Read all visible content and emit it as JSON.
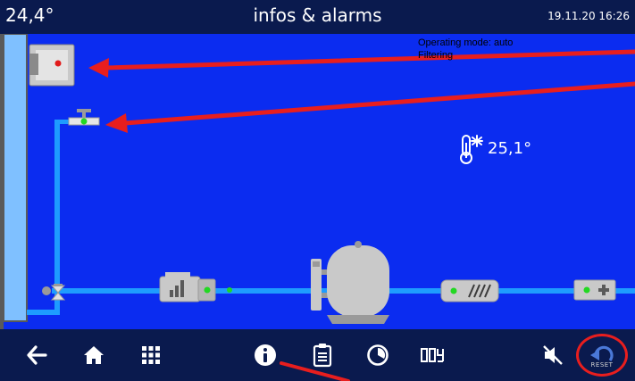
{
  "header": {
    "pool_temperature": "24,4°",
    "title": "infos & alarms",
    "datetime": "19.11.20 16:26"
  },
  "status": {
    "operating_mode": "Operating mode: auto",
    "state": "Filtering"
  },
  "setpoint": {
    "temperature": "25,1°",
    "icon": "thermometer-snowflake-icon"
  },
  "components": {
    "cover_unit": {
      "icon": "control-box-icon",
      "indicator_color": "#e11b1b"
    },
    "valve": {
      "icon": "valve-icon",
      "state": "open",
      "indicator_color": "#22d822"
    },
    "three_way_valve": {
      "icon": "three-way-valve-icon"
    },
    "pump": {
      "icon": "pump-icon",
      "status": "running",
      "indicator_color": "#22d822"
    },
    "filter": {
      "icon": "sand-filter-icon"
    },
    "heater": {
      "icon": "heater-icon",
      "status": "on",
      "indicator_color": "#22d822"
    },
    "dosing": {
      "icon": "chlorine-dosing-icon",
      "indicator_color": "#22d822"
    }
  },
  "bottom_nav": [
    {
      "name": "back-arrow-icon",
      "label": "back"
    },
    {
      "name": "home-icon",
      "label": "home"
    },
    {
      "name": "grid-menu-icon",
      "label": "menu"
    },
    {
      "name": "info-icon",
      "label": "infos & alarms",
      "active": true
    },
    {
      "name": "clipboard-icon",
      "label": "log"
    },
    {
      "name": "timer-icon",
      "label": "timer"
    },
    {
      "name": "digital-counter-icon",
      "label": "counter"
    },
    {
      "name": "mute-icon",
      "label": "mute"
    },
    {
      "name": "reset-icon",
      "label": "RESET"
    }
  ],
  "colors": {
    "background": "#0b2cf0",
    "bar": "#0a1a4e",
    "pipe": "#1e9cff",
    "annotation_arrow": "#e81e1e",
    "led_green": "#22d822",
    "led_red": "#e11b1b"
  },
  "reset_label": "RESET"
}
